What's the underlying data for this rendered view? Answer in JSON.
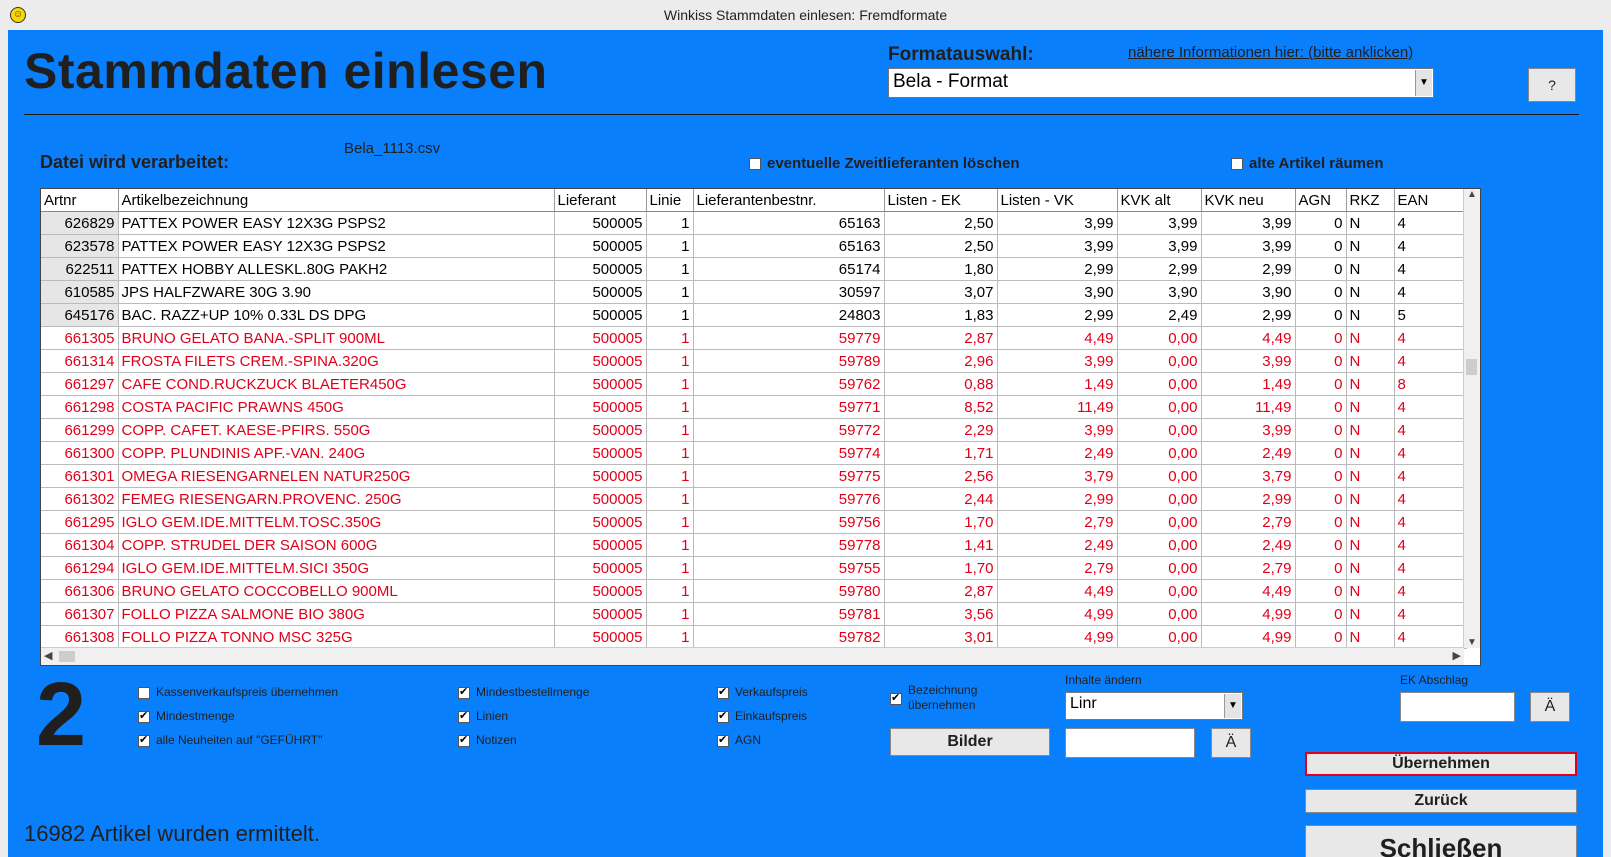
{
  "window": {
    "title": "Winkiss Stammdaten einlesen: Fremdformate"
  },
  "header": {
    "title": "Stammdaten einlesen",
    "format_label": "Formatauswahl:",
    "info_link": "nähere Informationen hier: (bitte anklicken)",
    "format_value": "Bela - Format",
    "help_label": "?"
  },
  "file": {
    "label": "Datei wird verarbeitet:",
    "name": "Bela_1113.csv"
  },
  "top_options": {
    "zweitlieferanten": {
      "label": "eventuelle Zweitlieferanten löschen",
      "checked": false
    },
    "alte_artikel": {
      "label": "alte Artikel räumen",
      "checked": false
    }
  },
  "grid": {
    "columns": [
      "Artnr",
      "Artikelbezeichnung",
      "Lieferant",
      "Linie",
      "Lieferantenbestnr.",
      "Listen - EK",
      "Listen - VK",
      "KVK alt",
      "KVK neu",
      "AGN",
      "RKZ",
      "EAN"
    ],
    "rows": [
      {
        "style": "black",
        "cells": [
          "626829",
          "PATTEX POWER EASY 12X3G  PSPS2",
          "500005",
          "1",
          "65163",
          "2,50",
          "3,99",
          "3,99",
          "3,99",
          "0",
          "N",
          "4"
        ]
      },
      {
        "style": "black",
        "cells": [
          "623578",
          "PATTEX POWER EASY 12X3G  PSPS2",
          "500005",
          "1",
          "65163",
          "2,50",
          "3,99",
          "3,99",
          "3,99",
          "0",
          "N",
          "4"
        ]
      },
      {
        "style": "black",
        "cells": [
          "622511",
          "PATTEX HOBBY ALLESKL.80G PAKH2",
          "500005",
          "1",
          "65174",
          "1,80",
          "2,99",
          "2,99",
          "2,99",
          "0",
          "N",
          "4"
        ]
      },
      {
        "style": "black",
        "cells": [
          "610585",
          "JPS HALFZWARE 30G         3.90",
          "500005",
          "1",
          "30597",
          "3,07",
          "3,90",
          "3,90",
          "3,90",
          "0",
          "N",
          "4"
        ]
      },
      {
        "style": "black",
        "cells": [
          "645176",
          "BAC. RAZZ+UP 10% 0.33L DS  DPG",
          "500005",
          "1",
          "24803",
          "1,83",
          "2,99",
          "2,49",
          "2,99",
          "0",
          "N",
          "5"
        ]
      },
      {
        "style": "red",
        "cells": [
          "661305",
          "BRUNO GELATO BANA.-SPLIT 900ML",
          "500005",
          "1",
          "59779",
          "2,87",
          "4,49",
          "0,00",
          "4,49",
          "0",
          "N",
          "4"
        ]
      },
      {
        "style": "red",
        "cells": [
          "661314",
          "FROSTA FILETS CREM.-SPINA.320G",
          "500005",
          "1",
          "59789",
          "2,96",
          "3,99",
          "0,00",
          "3,99",
          "0",
          "N",
          "4"
        ]
      },
      {
        "style": "red",
        "cells": [
          "661297",
          "CAFE COND.RUCKZUCK BLAETER450G",
          "500005",
          "1",
          "59762",
          "0,88",
          "1,49",
          "0,00",
          "1,49",
          "0",
          "N",
          "8"
        ]
      },
      {
        "style": "red",
        "cells": [
          "661298",
          "COSTA PACIFIC PRAWNS       450G",
          "500005",
          "1",
          "59771",
          "8,52",
          "11,49",
          "0,00",
          "11,49",
          "0",
          "N",
          "4"
        ]
      },
      {
        "style": "red",
        "cells": [
          "661299",
          "COPP. CAFET. KAESE-PFIRS. 550G",
          "500005",
          "1",
          "59772",
          "2,29",
          "3,99",
          "0,00",
          "3,99",
          "0",
          "N",
          "4"
        ]
      },
      {
        "style": "red",
        "cells": [
          "661300",
          "COPP. PLUNDINIS APF.-VAN. 240G",
          "500005",
          "1",
          "59774",
          "1,71",
          "2,49",
          "0,00",
          "2,49",
          "0",
          "N",
          "4"
        ]
      },
      {
        "style": "red",
        "cells": [
          "661301",
          "OMEGA RIESENGARNELEN NATUR250G",
          "500005",
          "1",
          "59775",
          "2,56",
          "3,79",
          "0,00",
          "3,79",
          "0",
          "N",
          "4"
        ]
      },
      {
        "style": "red",
        "cells": [
          "661302",
          "FEMEG RIESENGARN.PROVENC. 250G",
          "500005",
          "1",
          "59776",
          "2,44",
          "2,99",
          "0,00",
          "2,99",
          "0",
          "N",
          "4"
        ]
      },
      {
        "style": "red",
        "cells": [
          "661295",
          "IGLO GEM.IDE.MITTELM.TOSC.350G",
          "500005",
          "1",
          "59756",
          "1,70",
          "2,79",
          "0,00",
          "2,79",
          "0",
          "N",
          "4"
        ]
      },
      {
        "style": "red",
        "cells": [
          "661304",
          "COPP. STRUDEL DER SAISON  600G",
          "500005",
          "1",
          "59778",
          "1,41",
          "2,49",
          "0,00",
          "2,49",
          "0",
          "N",
          "4"
        ]
      },
      {
        "style": "red",
        "cells": [
          "661294",
          "IGLO GEM.IDE.MITTELM.SICI 350G",
          "500005",
          "1",
          "59755",
          "1,70",
          "2,79",
          "0,00",
          "2,79",
          "0",
          "N",
          "4"
        ]
      },
      {
        "style": "red",
        "cells": [
          "661306",
          "BRUNO GELATO COCCOBELLO  900ML",
          "500005",
          "1",
          "59780",
          "2,87",
          "4,49",
          "0,00",
          "4,49",
          "0",
          "N",
          "4"
        ]
      },
      {
        "style": "red",
        "cells": [
          "661307",
          "FOLLO PIZZA SALMONE BIO   380G",
          "500005",
          "1",
          "59781",
          "3,56",
          "4,99",
          "0,00",
          "4,99",
          "0",
          "N",
          "4"
        ]
      },
      {
        "style": "red",
        "cells": [
          "661308",
          "FOLLO PIZZA TONNO MSC     325G",
          "500005",
          "1",
          "59782",
          "3,01",
          "4,99",
          "0,00",
          "4,99",
          "0",
          "N",
          "4"
        ]
      }
    ]
  },
  "step_number": "2",
  "options": {
    "col1": [
      {
        "label": "Kassenverkaufspreis übernehmen",
        "checked": false
      },
      {
        "label": "Mindestmenge",
        "checked": true
      },
      {
        "label": "alle Neuheiten auf  \"GEFÜHRT\"",
        "checked": true
      }
    ],
    "col2": [
      {
        "label": "Mindestbestellmenge",
        "checked": true
      },
      {
        "label": "Linien",
        "checked": true
      },
      {
        "label": "Notizen",
        "checked": true
      }
    ],
    "col3": [
      {
        "label": "Verkaufspreis",
        "checked": true
      },
      {
        "label": "Einkaufspreis",
        "checked": true
      },
      {
        "label": "AGN",
        "checked": true
      }
    ],
    "bezeichnung": {
      "line1": "Bezeichnung",
      "line2": "übernehmen",
      "checked": true
    }
  },
  "inhalte": {
    "label": "Inhalte ändern",
    "select_value": "Linr",
    "input_value": "",
    "apply_label": "Ä"
  },
  "ek_abschlag": {
    "label": "EK Abschlag",
    "input_value": "",
    "apply_label": "Ä"
  },
  "buttons": {
    "bilder": "Bilder",
    "uebernehmen": "Übernehmen",
    "zurueck": "Zurück",
    "schliessen": "Schließen"
  },
  "status": "16982 Artikel wurden ermittelt.",
  "colors": {
    "background": "#0a7ffc",
    "new_row_text": "#e0001a",
    "accent_border": "#e0001a"
  }
}
